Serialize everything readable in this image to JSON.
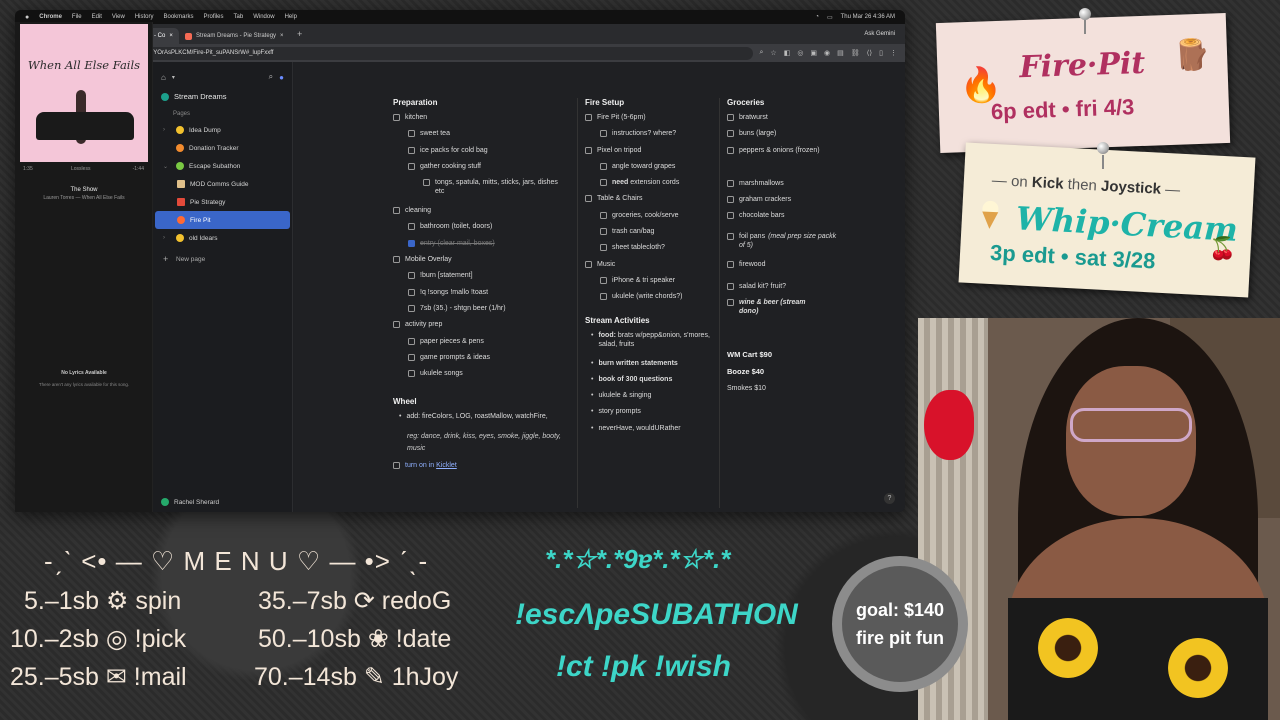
{
  "menubar": {
    "app": "Chrome",
    "items": [
      "File",
      "Edit",
      "View",
      "History",
      "Bookmarks",
      "Profiles",
      "Tab",
      "Window",
      "Help"
    ],
    "clock": "Thu Mar 26  4:36 AM"
  },
  "tabs": [
    {
      "label": "Stream Dreams - Fire Pit - Co"
    },
    {
      "label": "Stream Dreams - Pie Strategy"
    }
  ],
  "toolbar": {
    "url": "coda.io/d/Stream-Dreams_dYOrAsPLKCM/Fire-Pit_suPANSrW#_lupFxxff",
    "ask_gemini": "Ask Gemini"
  },
  "player": {
    "album_title": "When All Else Fails",
    "time_elapsed": "1:35",
    "quality": "Lossless",
    "time_remaining": "-1:44",
    "song": "The Show",
    "artist": "Lauren Torres — When All Else Fails",
    "no_lyrics": "No Lyrics Available",
    "no_lyrics_sub": "There aren't any lyrics available for this song."
  },
  "sidebar": {
    "doc_title": "Stream Dreams",
    "section": "Pages",
    "items": [
      {
        "label": "Idea Dump",
        "color": "#f2c12e"
      },
      {
        "label": "Donation Tracker",
        "color": "#f28b2e"
      },
      {
        "label": "Escape Subathon",
        "color": "#7ac943"
      },
      {
        "label": "MOD Comms Guide",
        "color": "#e0c08a"
      },
      {
        "label": "Pie Strategy",
        "color": "#e34a3a"
      },
      {
        "label": "Fire Pit",
        "color": "#ff6a33"
      },
      {
        "label": "old Idears",
        "color": "#f2c12e"
      }
    ],
    "new_page": "New page",
    "user": "Rachel Sherard"
  },
  "doc": {
    "col1": {
      "heading": "Preparation",
      "rows": [
        {
          "label": "kitchen",
          "level": 0,
          "checked": false
        },
        {
          "label": "sweet tea",
          "level": 1,
          "checked": false
        },
        {
          "label": "ice packs for cold bag",
          "level": 1,
          "checked": false
        },
        {
          "label": "gather cooking stuff",
          "level": 1,
          "checked": false
        },
        {
          "label": "tongs, spatula, mitts, sticks, jars, dishes etc",
          "level": 2,
          "checked": false
        },
        {
          "label": "cleaning",
          "level": 0,
          "checked": false
        },
        {
          "label": "bathroom (toilet, doors)",
          "level": 1,
          "checked": false
        },
        {
          "label": "entry (clear mail, boxes)",
          "level": 1,
          "checked": true
        },
        {
          "label": "Mobile Overlay",
          "level": 0,
          "checked": false
        },
        {
          "label": "!burn [statement]",
          "level": 1,
          "checked": false
        },
        {
          "label": "!q !songs !mallo !toast",
          "level": 1,
          "checked": false
        },
        {
          "label": "7sb (35.) - shtgn beer (1/hr)",
          "level": 1,
          "checked": false
        },
        {
          "label": "activity prep",
          "level": 0,
          "checked": false
        },
        {
          "label": "paper pieces & pens",
          "level": 1,
          "checked": false
        },
        {
          "label": "game prompts & ideas",
          "level": 1,
          "checked": false
        },
        {
          "label": "ukulele songs",
          "level": 1,
          "checked": false
        }
      ],
      "wheel_heading": "Wheel",
      "wheel_add": "add: fireColors, LOG, roastMallow, watchFire,",
      "wheel_reg": "reg: dance, drink, kiss, eyes, smoke, jiggle, booty, music",
      "turn_on": "turn on in",
      "kicklet": "Kicklet"
    },
    "col2": {
      "heading": "Fire Setup",
      "rows": [
        {
          "label": "Fire Pit (5-6pm)",
          "level": 0
        },
        {
          "label": "instructions? where?",
          "level": 1
        },
        {
          "label": "Pixel on tripod",
          "level": 0
        },
        {
          "label": "angle toward grapes",
          "level": 1
        },
        {
          "label_bold": "need",
          "label": " extension cords",
          "level": 1
        },
        {
          "label": "Table & Chairs",
          "level": 0
        },
        {
          "label": "groceries, cook/serve",
          "level": 1
        },
        {
          "label": "trash can/bag",
          "level": 1
        },
        {
          "label": "sheet tablecloth?",
          "level": 1
        },
        {
          "label": "Music",
          "level": 0
        },
        {
          "label": "iPhone & tri speaker",
          "level": 1
        },
        {
          "label": "ukulele (write chords?)",
          "level": 1
        }
      ],
      "activities_heading": "Stream Activities",
      "activities": [
        {
          "bold": "food:",
          "text": " brats w/pepp&onion, s'mores, salad, fruits"
        },
        {
          "bold": "burn written statements",
          "text": ""
        },
        {
          "bold": "book of 300 questions",
          "text": ""
        },
        {
          "bold": "",
          "text": "ukulele & singing"
        },
        {
          "bold": "",
          "text": "story prompts"
        },
        {
          "bold": "",
          "text": "neverHave, wouldURather"
        }
      ]
    },
    "col3": {
      "heading": "Groceries",
      "rows": [
        {
          "label": "bratwurst"
        },
        {
          "label": "buns (large)"
        },
        {
          "label": "peppers & onions (frozen)"
        },
        {
          "label": "marshmallows"
        },
        {
          "label": "graham crackers"
        },
        {
          "label": "chocolate bars"
        },
        {
          "label": "foil pans",
          "note": "(meal prep size packk of 5)"
        },
        {
          "label": "firewood"
        },
        {
          "label": "salad kit? fruit?"
        },
        {
          "label_bold": "wine & beer (stream dono)"
        }
      ],
      "wm_cart": "WM Cart $90",
      "booze": "Booze $40",
      "smokes": "Smokes $10"
    },
    "help": "?"
  },
  "card_fire": {
    "title": "Fire·Pit",
    "sub": "6p edt • fri 4/3"
  },
  "card_whip": {
    "top_pre": "— on ",
    "top_kick": "Kick",
    "top_mid": " then ",
    "top_joy": "Joystick",
    "top_post": " —",
    "title": "Whip·Cream",
    "sub": "3p edt • sat 3/28"
  },
  "menu": {
    "title": "-ˏˋ <• — ♡ M E N U ♡ — •> ˊˎ-",
    "rows": [
      "5.–1sb ⚙ spin",
      "10.–2sb ◎ !pick",
      "25.–5sb ✉ !mail",
      "35.–7sb ⟳ redoG",
      "50.–10sb ❀ !date",
      "70.–14sb ✎ 1hJoy"
    ]
  },
  "subathon": {
    "deco": "*.*☆*.*9ɐ*.*☆*.*",
    "name": "!escΛpeSUBATHON",
    "cmds": "!ct !pk !wish"
  },
  "goal": {
    "line1": "goal: $140",
    "line2": "fire pit fun"
  },
  "colors": {
    "accent_blue": "#3a66c9",
    "teal": "#3dd6c8",
    "fire_pink": "#b03060"
  }
}
